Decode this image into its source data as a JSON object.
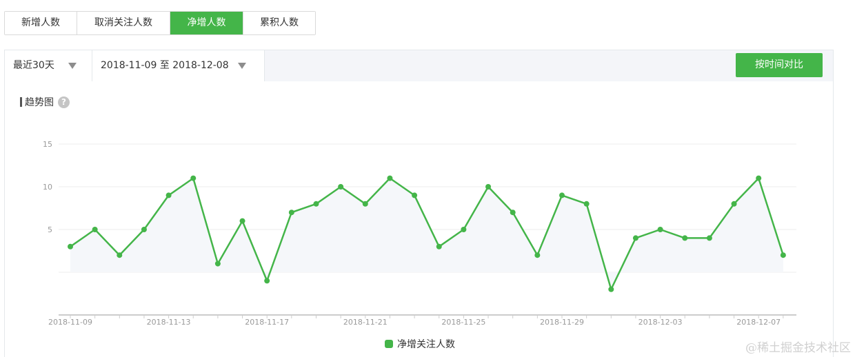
{
  "tabs": [
    {
      "label": "新增人数",
      "active": false
    },
    {
      "label": "取消关注人数",
      "active": false
    },
    {
      "label": "净增人数",
      "active": true
    },
    {
      "label": "累积人数",
      "active": false
    }
  ],
  "toolbar": {
    "period": "最近30天",
    "range": "2018-11-09 至 2018-12-08",
    "compare_button": "按时间对比"
  },
  "section": {
    "title": "趋势图",
    "help": "?"
  },
  "watermark": "@稀土掘金技术社区",
  "colors": {
    "accent": "#44b549"
  },
  "chart_data": {
    "type": "line",
    "title": "",
    "xlabel": "",
    "ylabel": "",
    "ylim": [
      -5,
      15
    ],
    "yticks": [
      5,
      10,
      15
    ],
    "grid": true,
    "legend": "bottom-center",
    "x": [
      "2018-11-09",
      "2018-11-10",
      "2018-11-11",
      "2018-11-12",
      "2018-11-13",
      "2018-11-14",
      "2018-11-15",
      "2018-11-16",
      "2018-11-17",
      "2018-11-18",
      "2018-11-19",
      "2018-11-20",
      "2018-11-21",
      "2018-11-22",
      "2018-11-23",
      "2018-11-24",
      "2018-11-25",
      "2018-11-26",
      "2018-11-27",
      "2018-11-28",
      "2018-11-29",
      "2018-11-30",
      "2018-12-01",
      "2018-12-02",
      "2018-12-03",
      "2018-12-04",
      "2018-12-05",
      "2018-12-06",
      "2018-12-07",
      "2018-12-08"
    ],
    "xtick_labels": [
      "2018-11-09",
      "2018-11-13",
      "2018-11-17",
      "2018-11-21",
      "2018-11-25",
      "2018-11-29",
      "2018-12-03",
      "2018-12-07"
    ],
    "series": [
      {
        "name": "净增关注人数",
        "color": "#44b549",
        "values": [
          3,
          5,
          2,
          5,
          9,
          11,
          1,
          6,
          -1,
          7,
          8,
          10,
          8,
          11,
          9,
          3,
          5,
          10,
          7,
          2,
          9,
          8,
          -2,
          4,
          5,
          4,
          4,
          8,
          11,
          2
        ]
      }
    ]
  }
}
